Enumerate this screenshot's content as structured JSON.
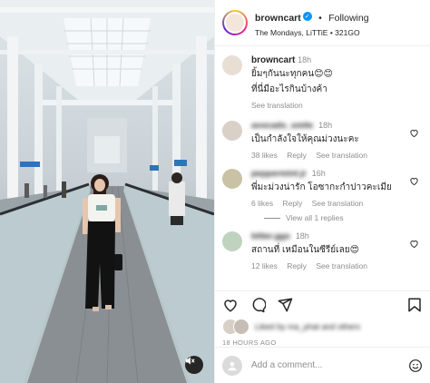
{
  "post": {
    "username": "browncart",
    "follow_status": "Following",
    "separator": "•",
    "subtitle": "The Mondays, LiTTiE • 321GO",
    "caption": {
      "username": "browncart",
      "time": "18h",
      "line1": "ยิ้มๆกันนะทุกคน😊😊",
      "line2": "ที่นี่มีอะไรกินบ้างค้า",
      "see_translation": "See translation"
    }
  },
  "comments": [
    {
      "username": "avocado_smile",
      "time": "18h",
      "text": "เป็นกำลังใจให้คุณม่วงนะคะ",
      "likes": "38 likes",
      "reply": "Reply",
      "see_translation": "See translation"
    },
    {
      "username": "peppermint.jr",
      "time": "16h",
      "text": "พี่มะม่วงน่ารัก โอซากะกำปาวคะเมีย",
      "likes": "6 likes",
      "reply": "Reply",
      "see_translation": "See translation",
      "view_replies": "View all 1 replies"
    },
    {
      "username": "bitter.ggs",
      "time": "18h",
      "text": "สถานที่ เหมือนในซีรีย์เลย😍",
      "likes": "12 likes",
      "reply": "Reply",
      "see_translation": "See translation"
    }
  ],
  "actions": {
    "liked_by": "Liked by ma_phat and others",
    "timestamp": "18 HOURS AGO"
  },
  "add_comment": {
    "placeholder": "Add a comment..."
  },
  "icons": {
    "mute": "volume-mute-icon",
    "verified": "verified-badge-icon",
    "like": "heart-icon",
    "comment": "comment-bubble-icon",
    "share": "paper-plane-icon",
    "save": "bookmark-icon",
    "emoji": "smiley-icon"
  },
  "colors": {
    "verified": "#0095f6",
    "muted_text": "#8e8e8e",
    "text": "#262626"
  }
}
